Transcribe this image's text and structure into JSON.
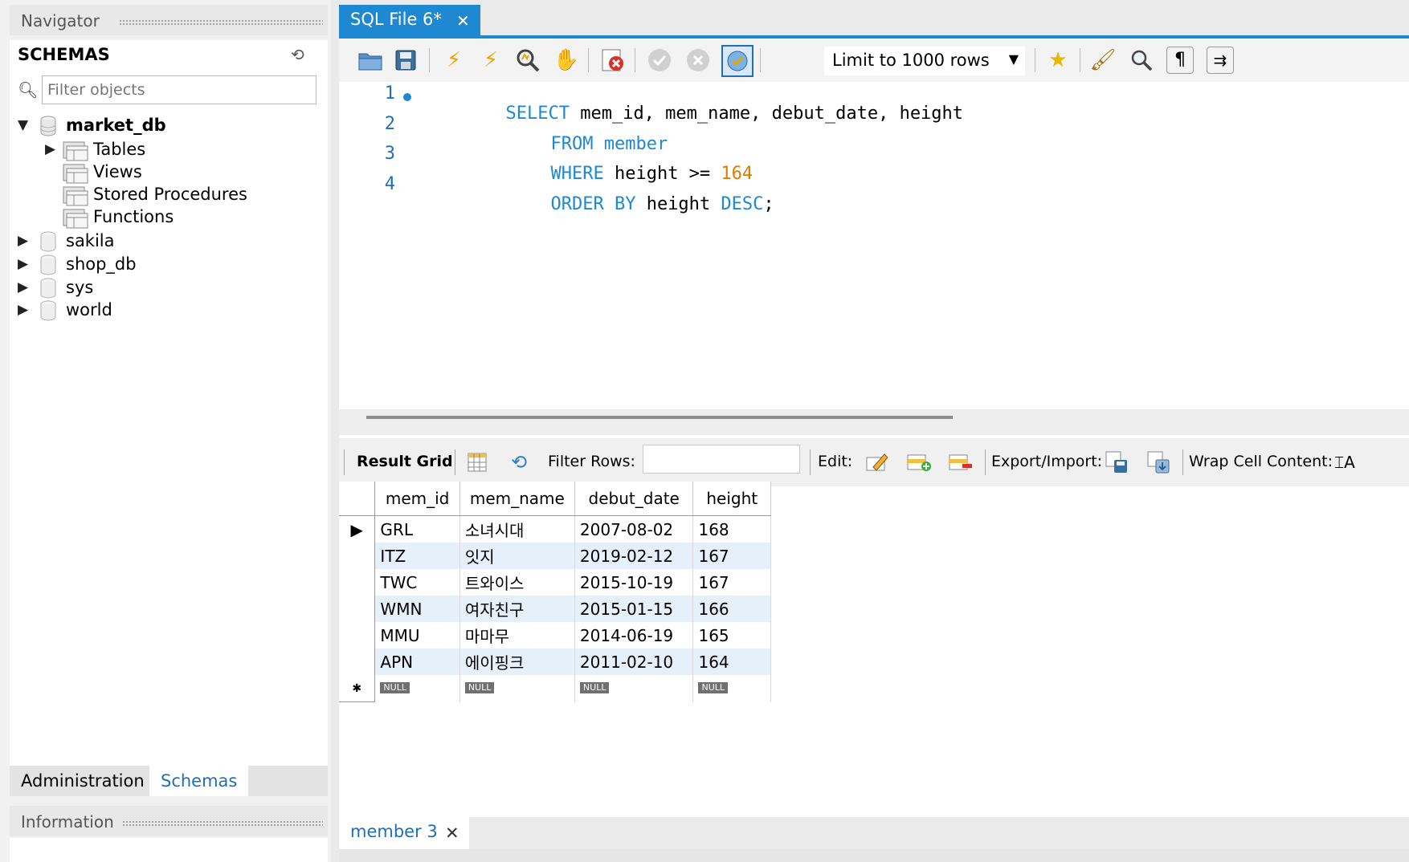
{
  "left": {
    "navigator_title": "Navigator",
    "schemas_title": "SCHEMAS",
    "filter_placeholder": "Filter objects",
    "tree": {
      "market_db": "market_db",
      "children": [
        "Tables",
        "Views",
        "Stored Procedures",
        "Functions"
      ],
      "others": [
        "sakila",
        "shop_db",
        "sys",
        "world"
      ]
    },
    "tabs": [
      "Administration",
      "Schemas"
    ],
    "information_title": "Information"
  },
  "editor": {
    "tab_title": "SQL File 6*",
    "limit": "Limit to 1000 rows",
    "lines": [
      {
        "num": "1",
        "parts": [
          {
            "k": "SELECT"
          },
          {
            "t": " mem_id, mem_name, debut_date, height"
          }
        ]
      },
      {
        "num": "2",
        "parts": [
          {
            "k": "FROM"
          },
          {
            "t": " "
          },
          {
            "k": "member"
          }
        ]
      },
      {
        "num": "3",
        "parts": [
          {
            "k": "WHERE"
          },
          {
            "t": " height >= "
          },
          {
            "n": "164"
          }
        ]
      },
      {
        "num": "4",
        "parts": [
          {
            "k": "ORDER BY"
          },
          {
            "t": " height "
          },
          {
            "k": "DESC"
          },
          {
            "t": ";"
          }
        ]
      }
    ]
  },
  "result_bar": {
    "result_grid": "Result Grid",
    "filter_rows": "Filter Rows:",
    "edit": "Edit:",
    "export_import": "Export/Import:",
    "wrap_cell": "Wrap Cell Content:"
  },
  "grid": {
    "columns": [
      "mem_id",
      "mem_name",
      "debut_date",
      "height"
    ],
    "rows": [
      [
        "GRL",
        "소녀시대",
        "2007-08-02",
        "168"
      ],
      [
        "ITZ",
        "잇지",
        "2019-02-12",
        "167"
      ],
      [
        "TWC",
        "트와이스",
        "2015-10-19",
        "167"
      ],
      [
        "WMN",
        "여자친구",
        "2015-01-15",
        "166"
      ],
      [
        "MMU",
        "마마무",
        "2014-06-19",
        "165"
      ],
      [
        "APN",
        "에이핑크",
        "2011-02-10",
        "164"
      ]
    ],
    "null_label": "NULL"
  },
  "results_tab": "member 3",
  "colors": {
    "accent": "#1e88d0",
    "keyword": "#1e88d0",
    "number": "#e07b00",
    "row_alt": "#e6f0fb"
  }
}
